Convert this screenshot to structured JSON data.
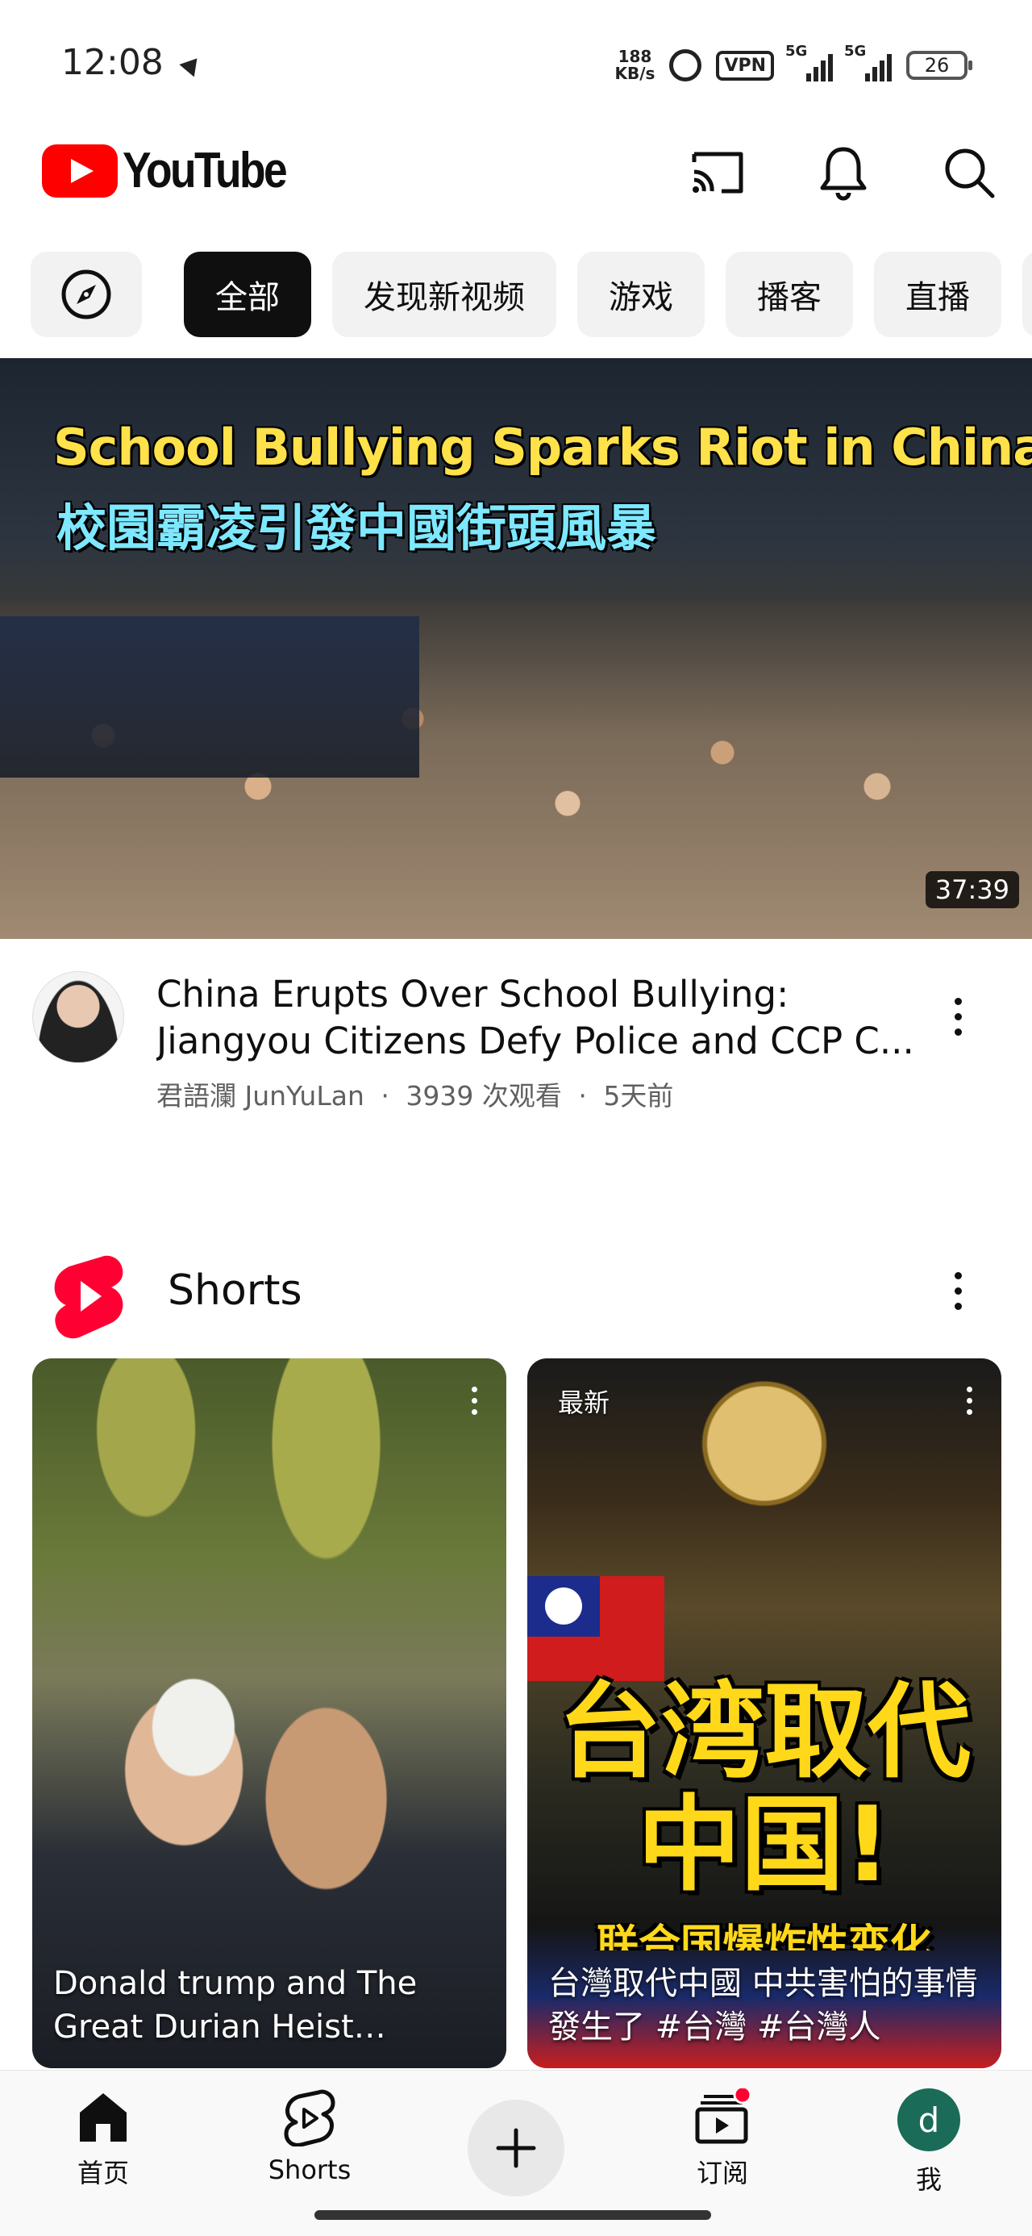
{
  "status_bar": {
    "time": "12:08",
    "net_speed_value": "188",
    "net_speed_unit": "KB/s",
    "vpn": "VPN",
    "signal1": "5G",
    "signal2": "5G",
    "battery": "26"
  },
  "header": {
    "logo_text": "YouTube",
    "icons": [
      "cast-icon",
      "notifications-icon",
      "search-icon"
    ]
  },
  "chips": {
    "explore_icon": "compass-icon",
    "items": [
      "全部",
      "发现新视频",
      "游戏",
      "播客",
      "直播"
    ],
    "selected": "全部"
  },
  "featured_video": {
    "thumbnail_title_en": "School Bullying Sparks Riot in China",
    "thumbnail_title_zh": "校園霸凌引發中國街頭風暴",
    "duration": "37:39",
    "title": "China Erupts Over School Bullying: Jiangyou Citizens Defy Police and CCP C...",
    "channel": "君語瀾 JunYuLan",
    "views": "3939 次观看",
    "age": "5天前",
    "separator": "·"
  },
  "shorts": {
    "section_title": "Shorts",
    "items": [
      {
        "caption": "Donald trump and The Great Durian Heist #donal...",
        "badge": ""
      },
      {
        "caption": "台灣取代中國 中共害怕的事情發生了 #台灣 #台灣人",
        "badge": "最新",
        "overlay_line1": "台湾取代",
        "overlay_line2": "中国!",
        "overlay_line3": "联合国爆炸性变化"
      }
    ]
  },
  "bottom_nav": {
    "home": "首页",
    "shorts": "Shorts",
    "subscriptions": "订阅",
    "me": "我",
    "me_avatar_letter": "d"
  },
  "colors": {
    "brand_red": "#ff0000",
    "chip_active_bg": "#0f0f0f",
    "chip_bg": "#f2f2f2",
    "secondary_text": "#606060",
    "avatar_bg": "#1a6b58"
  }
}
